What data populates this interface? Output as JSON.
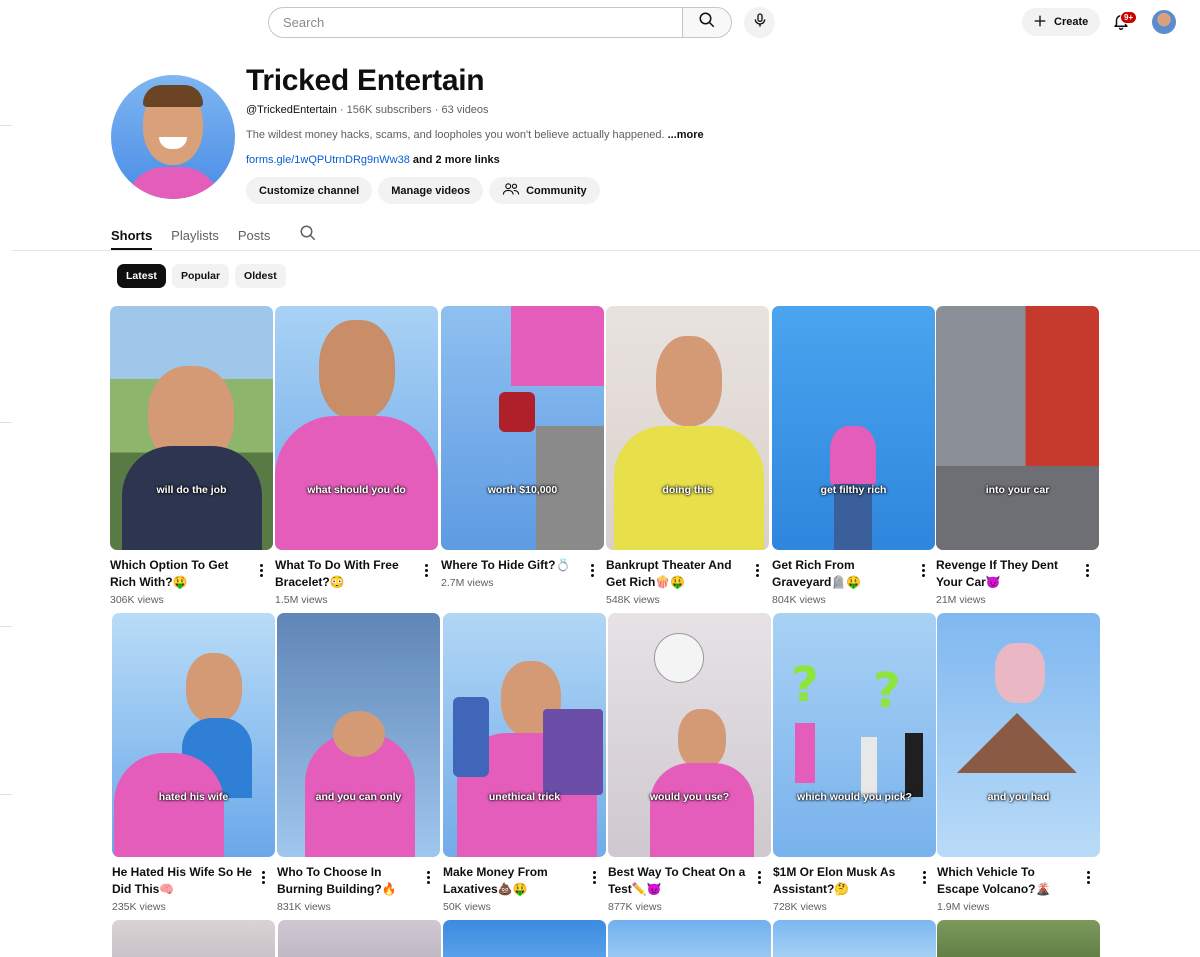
{
  "search": {
    "placeholder": "Search"
  },
  "header": {
    "create_label": "Create",
    "notifications_badge": "9+"
  },
  "channel": {
    "name": "Tricked Entertain",
    "handle": "@TrickedEntertain",
    "subscribers": "156K subscribers",
    "videos": "63 videos",
    "description": "The wildest money hacks, scams, and loopholes you won't believe actually happened.",
    "description_more": "...more",
    "link": "forms.gle/1wQPUtrnDRg9nWw38",
    "more_links": "and 2 more links",
    "actions": [
      "Customize channel",
      "Manage videos",
      "Community"
    ]
  },
  "tabs": [
    "Shorts",
    "Playlists",
    "Posts"
  ],
  "filters": [
    "Latest",
    "Popular",
    "Oldest"
  ],
  "shorts": [
    {
      "title": "Which Option To Get Rich With?🤑",
      "views": "306K views",
      "caption": "will do the job"
    },
    {
      "title": "What To Do With Free Bracelet?😳",
      "views": "1.5M views",
      "caption": "what should you do"
    },
    {
      "title": "Where To Hide Gift?💍",
      "views": "2.7M views",
      "caption": "worth $10,000"
    },
    {
      "title": "Bankrupt Theater And Get Rich🍿🤑",
      "views": "548K views",
      "caption": "doing this"
    },
    {
      "title": "Get Rich From Graveyard🪦🤑",
      "views": "804K views",
      "caption": "get filthy rich"
    },
    {
      "title": "Revenge If They Dent Your Car😈",
      "views": "21M views",
      "caption": "into your car"
    },
    {
      "title": "He Hated His Wife So He Did This🧠",
      "views": "235K views",
      "caption": "hated his wife"
    },
    {
      "title": "Who To Choose In Burning Building?🔥",
      "views": "831K views",
      "caption": "and you can only"
    },
    {
      "title": "Make Money From Laxatives💩🤑",
      "views": "50K views",
      "caption": "unethical trick"
    },
    {
      "title": "Best Way To Cheat On a Test✏️😈",
      "views": "877K views",
      "caption": "would you use?"
    },
    {
      "title": "$1M Or Elon Musk As Assistant?🤔",
      "views": "728K views",
      "caption": "which would you pick?"
    },
    {
      "title": "Which Vehicle To Escape Volcano?🌋",
      "views": "1.9M views",
      "caption": "and you had"
    }
  ]
}
